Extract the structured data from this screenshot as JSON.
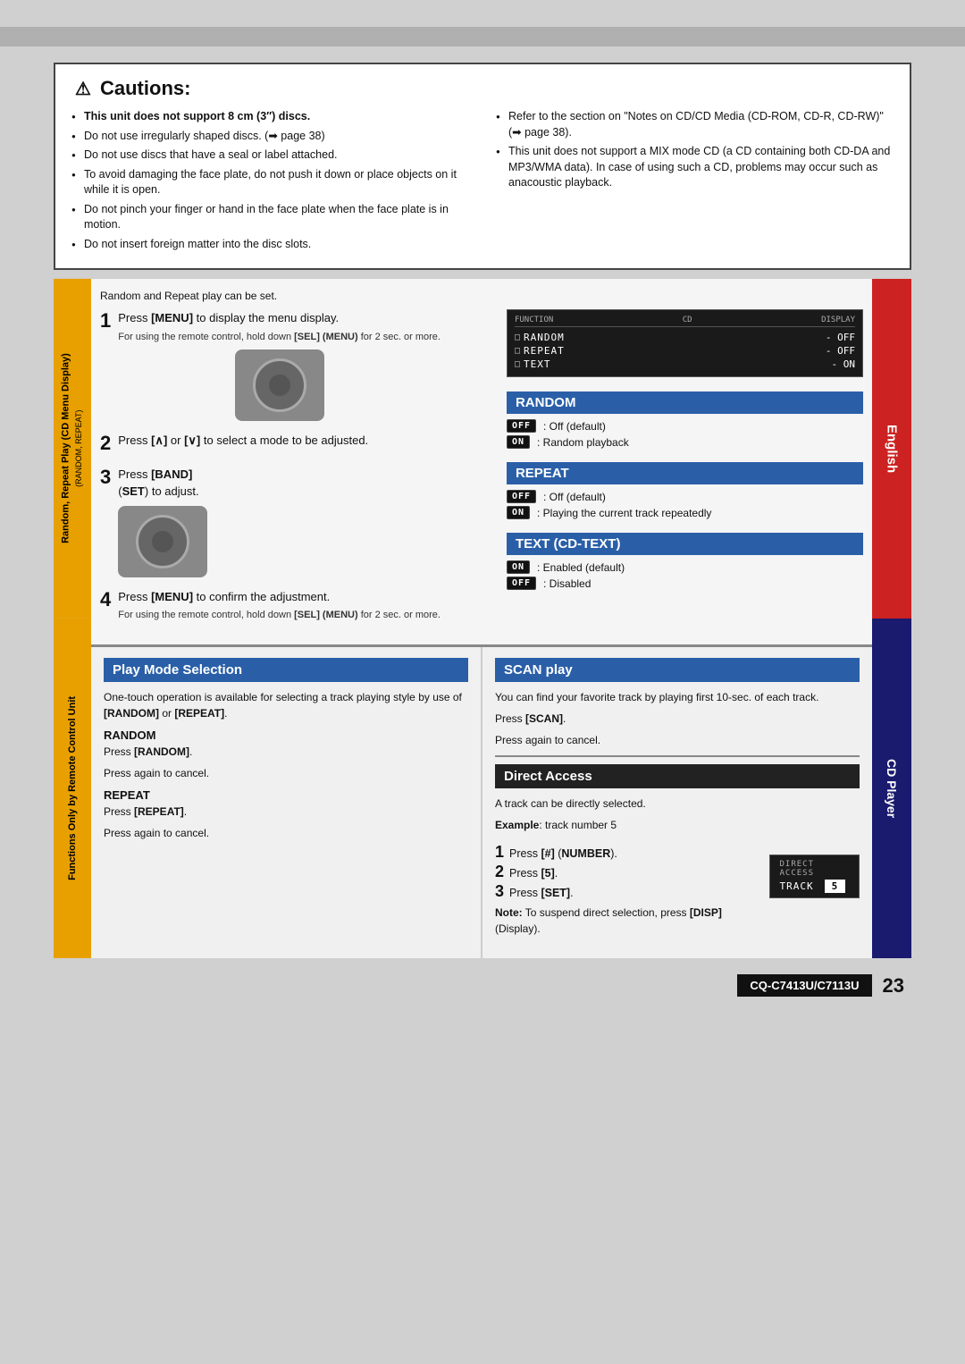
{
  "page": {
    "bg_color": "#d0d0d0",
    "page_number": "23",
    "model": "CQ-C7413U/C7113U"
  },
  "cautions": {
    "title": "Cautions:",
    "warning_symbol": "⚠",
    "left_items": [
      {
        "text": "This unit does not support 8 cm (3\") discs.",
        "bold": true
      },
      {
        "text": "Do not use irregularly shaped discs. (➡ page 38)"
      },
      {
        "text": "Do not use discs that have a seal or label attached."
      },
      {
        "text": "To avoid damaging the face plate, do not push it down or place objects on it while it is open."
      },
      {
        "text": "Do not pinch your finger or hand in the face plate when the face plate is in motion."
      },
      {
        "text": "Do not insert foreign matter into the disc slots."
      }
    ],
    "right_items": [
      {
        "text": "Refer to the section on \"Notes on CD/CD Media (CD-ROM, CD-R, CD-RW)\" (➡ page 38)."
      },
      {
        "text": "This unit does not support a MIX mode CD (a CD containing both CD-DA and MP3/WMA data). In case of using such a CD, problems may occur such as anacoustic playback."
      }
    ]
  },
  "sidebar_top": {
    "label": "Random, Repeat Play (CD Menu Display)",
    "sub_label": "(RANDOM, REPEAT)"
  },
  "sidebar_bottom": {
    "label": "Functions Only by Remote Control Unit"
  },
  "cd_menu": {
    "intro": "Random and Repeat play can be set.",
    "steps": [
      {
        "number": "1",
        "text": "Press [MENU] to display the menu display.",
        "note": "For using the remote control, hold down [SEL] (MENU) for 2 sec. or more."
      },
      {
        "number": "2",
        "text": "Press [∧] or [∨] to select a mode to be adjusted."
      },
      {
        "number": "3",
        "text": "Press [BAND] (SET) to adjust."
      },
      {
        "number": "4",
        "text": "Press [MENU] to confirm the adjustment.",
        "note": "For using the remote control, hold down [SEL] (MENU) for 2 sec. or more."
      }
    ],
    "display": {
      "header_left": "FUNCTION",
      "header_mid": "CD",
      "header_right": "DISPLAY",
      "rows": [
        {
          "check": "□",
          "label": "RANDOM",
          "value": "- OFF"
        },
        {
          "check": "□",
          "label": "REPEAT",
          "value": "- OFF"
        },
        {
          "check": "□",
          "label": "TEXT",
          "value": "- ON"
        }
      ]
    }
  },
  "random_section": {
    "title": "RANDOM",
    "options": [
      {
        "badge": "OFF",
        "desc": ": Off (default)"
      },
      {
        "badge": "ON",
        "desc": ": Random playback"
      }
    ]
  },
  "repeat_section": {
    "title": "REPEAT",
    "options": [
      {
        "badge": "OFF",
        "desc": ": Off (default)"
      },
      {
        "badge": "ON",
        "desc": ": Playing the current track repeatedly"
      }
    ]
  },
  "text_section": {
    "title": "TEXT (CD-TEXT)",
    "options": [
      {
        "badge": "ON",
        "desc": ": Enabled (default)"
      },
      {
        "badge": "OFF",
        "desc": ": Disabled"
      }
    ]
  },
  "play_mode": {
    "title": "Play Mode Selection",
    "body": "One-touch operation is available for selecting a track playing style by use of [RANDOM] or [REPEAT].",
    "random_heading": "RANDOM",
    "random_step1": "Press [RANDOM].",
    "random_step2": "Press again to cancel.",
    "repeat_heading": "REPEAT",
    "repeat_step1": "Press [REPEAT].",
    "repeat_step2": "Press again to cancel."
  },
  "scan_play": {
    "title": "SCAN play",
    "body": "You can find your favorite track by playing first 10-sec. of each track.",
    "step1": "Press [SCAN].",
    "step2": "Press again to cancel."
  },
  "direct_access": {
    "title": "Direct Access",
    "body": "A track can be directly selected.",
    "example_label": "Example",
    "example_text": ": track number 5",
    "steps": [
      {
        "number": "1",
        "text": "Press [#] (NUMBER)."
      },
      {
        "number": "2",
        "text": "Press [5]."
      },
      {
        "number": "3",
        "text": "Press [SET]."
      }
    ],
    "note": "Note: To suspend direct selection, press [DISP] (Display).",
    "display_label": "DIRECT ACCESS",
    "display_track": "TRACK",
    "display_value": "5"
  },
  "sidebar_right_top": "English",
  "sidebar_right_bottom": "CD Player"
}
